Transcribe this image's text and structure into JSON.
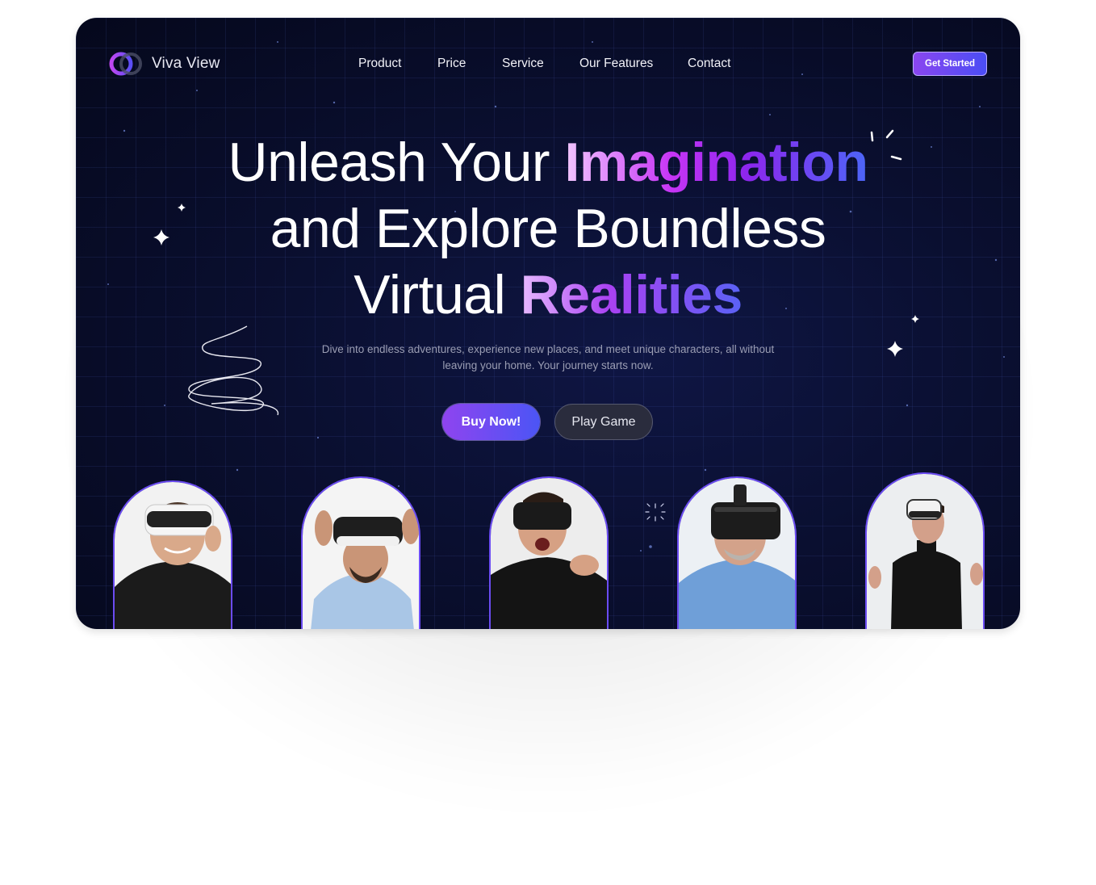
{
  "brand": {
    "name": "Viva View"
  },
  "nav": {
    "items": [
      {
        "label": "Product"
      },
      {
        "label": "Price"
      },
      {
        "label": "Service"
      },
      {
        "label": "Our Features"
      },
      {
        "label": "Contact"
      }
    ],
    "cta_label": "Get Started"
  },
  "hero": {
    "line1_plain": "Unleash Your ",
    "line1_highlight": "Imagination",
    "line2": "and Explore Boundless",
    "line3_plain": "Virtual ",
    "line3_highlight": "Realities",
    "description": "Dive into endless adventures, experience new places, and meet unique characters, all without leaving your home. Your journey starts now.",
    "primary_button": "Buy Now!",
    "secondary_button": "Play Game"
  },
  "gallery": {
    "items": [
      {
        "icon": "vr-user-photo",
        "background": "#f2f2f2",
        "headset": "white",
        "shirt": "#1b1b1b"
      },
      {
        "icon": "vr-user-photo",
        "background": "#f4f4f4",
        "headset": "black-white",
        "shirt": "#a9c6e6"
      },
      {
        "icon": "vr-user-photo",
        "background": "#ededed",
        "headset": "black",
        "shirt": "#141414"
      },
      {
        "icon": "vr-user-photo",
        "background": "#ecf0f4",
        "headset": "black",
        "shirt": "#6f9fd8"
      },
      {
        "icon": "vr-user-photo",
        "background": "#eceef0",
        "headset": "white-black",
        "shirt": "#141414"
      }
    ]
  },
  "colors": {
    "background": "#05081c",
    "accent_purple": "#8a46f0",
    "accent_blue": "#4a4df5",
    "arch_border": "#6b4cf2"
  }
}
